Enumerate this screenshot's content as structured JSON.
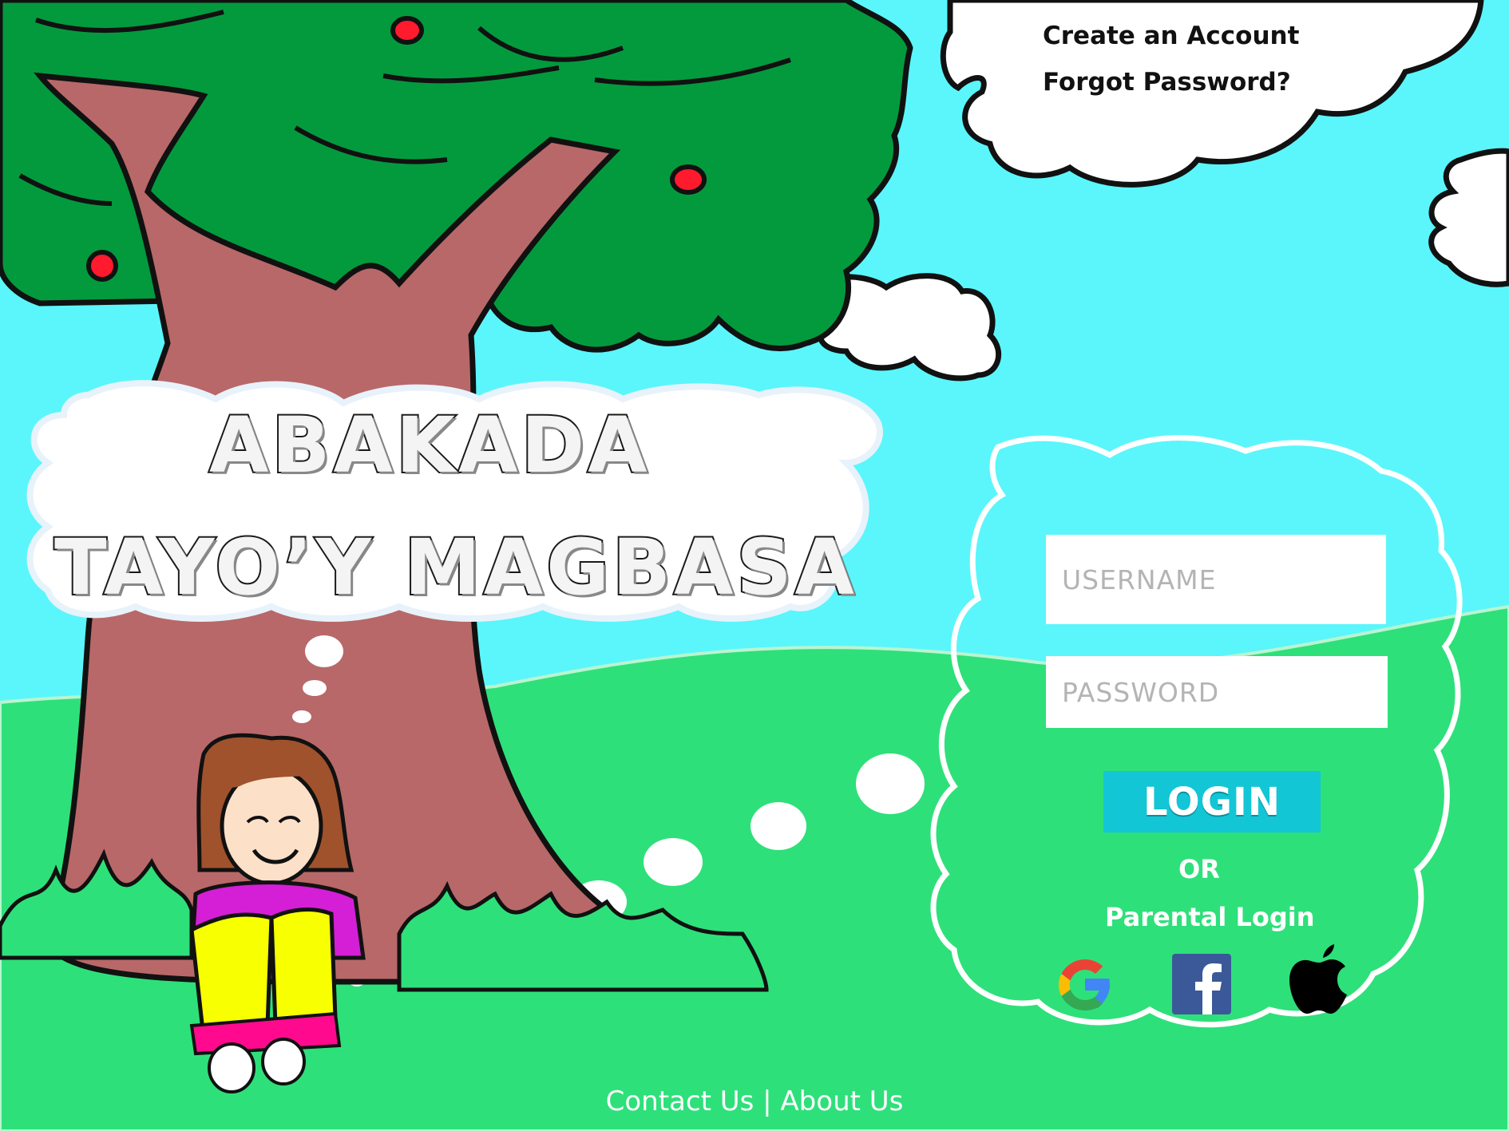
{
  "header_links": {
    "create_account": "Create an Account",
    "forgot_password": "Forgot Password?"
  },
  "title": {
    "line1": "ABAKADA",
    "line2": "TAYO’Y MAGBASA"
  },
  "login_form": {
    "username_placeholder": "USERNAME",
    "password_placeholder": "PASSWORD",
    "login_label": "LOGIN",
    "or_label": "OR",
    "parental_login_label": "Parental Login"
  },
  "social_icons": [
    "google-icon",
    "facebook-icon",
    "apple-icon"
  ],
  "footer": {
    "contact": "Contact Us",
    "separator": "|",
    "about": "About Us"
  },
  "colors": {
    "sky": "#5af6fb",
    "grass": "#2ee07a",
    "canopy": "#039a3e",
    "trunk": "#b86868",
    "login_button": "#12c6d6"
  }
}
